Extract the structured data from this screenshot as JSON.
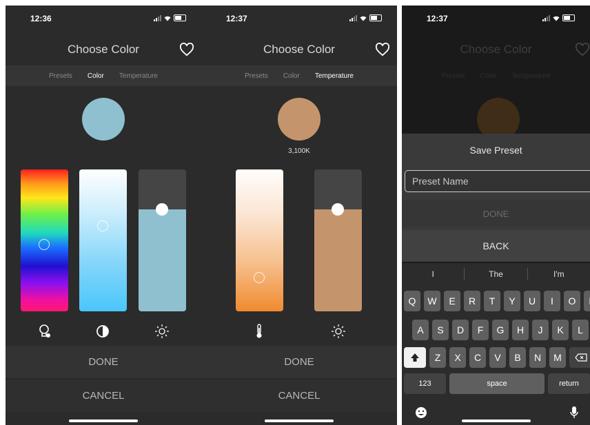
{
  "screens": [
    {
      "time": "12:36",
      "title": "Choose Color",
      "tabs": [
        "Presets",
        "Color",
        "Temperature"
      ],
      "active_tab": "Color",
      "swatch_color": "#8fc0cf",
      "sliders": [
        {
          "name": "hue",
          "thumb_fraction": 0.53
        },
        {
          "name": "saturation",
          "thumb_fraction": 0.4
        },
        {
          "name": "brightness",
          "level_fraction": 0.72
        }
      ],
      "icons": [
        "bulb-icon",
        "contrast-icon",
        "brightness-icon"
      ],
      "done_label": "DONE",
      "cancel_label": "CANCEL"
    },
    {
      "time": "12:37",
      "title": "Choose Color",
      "tabs": [
        "Presets",
        "Color",
        "Temperature"
      ],
      "active_tab": "Temperature",
      "swatch_color": "#c4956c",
      "kelvin": "3,100K",
      "sliders": [
        {
          "name": "temperature",
          "thumb_fraction": 0.76
        },
        {
          "name": "brightness",
          "level_fraction": 0.72
        }
      ],
      "icons": [
        "thermometer-icon",
        "brightness-icon"
      ],
      "done_label": "DONE",
      "cancel_label": "CANCEL"
    },
    {
      "time": "12:37",
      "title": "Choose Color",
      "tabs": [
        "Presets",
        "Color",
        "Temperature"
      ],
      "swatch_color": "#5a3a18",
      "sheet": {
        "title": "Save Preset",
        "input_placeholder": "Preset Name",
        "done_label": "DONE",
        "back_label": "BACK"
      },
      "keyboard": {
        "suggestions": [
          "I",
          "The",
          "I'm"
        ],
        "row1": [
          "Q",
          "W",
          "E",
          "R",
          "T",
          "Y",
          "U",
          "I",
          "O",
          "P"
        ],
        "row2": [
          "A",
          "S",
          "D",
          "F",
          "G",
          "H",
          "J",
          "K",
          "L"
        ],
        "row3": [
          "Z",
          "X",
          "C",
          "V",
          "B",
          "N",
          "M"
        ],
        "numbers_label": "123",
        "space_label": "space",
        "return_label": "return"
      }
    }
  ]
}
